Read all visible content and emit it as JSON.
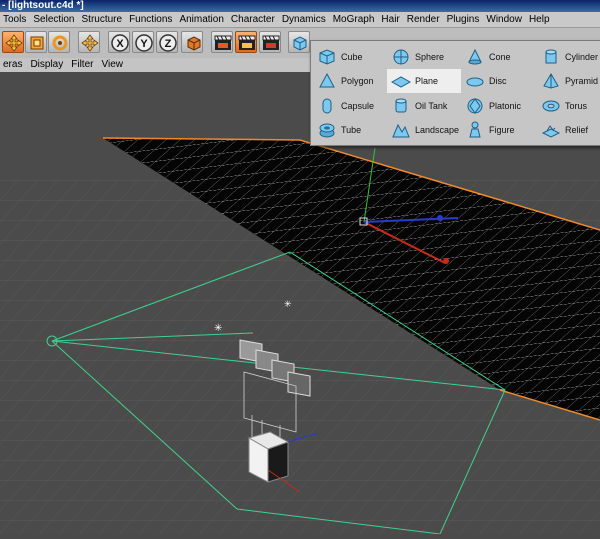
{
  "window": {
    "title": "- [lightsout.c4d *]"
  },
  "menubar": {
    "items": [
      "Tools",
      "Selection",
      "Structure",
      "Functions",
      "Animation",
      "Character",
      "Dynamics",
      "MoGraph",
      "Hair",
      "Render",
      "Plugins",
      "Window",
      "Help"
    ]
  },
  "toolbar": {
    "buttons": [
      "move-tool",
      "scale-tool",
      "rotate-tool",
      "live-selection",
      "x-axis-lock",
      "y-axis-lock",
      "z-axis-lock",
      "coordinate-system",
      "render-view",
      "render-picture-viewer",
      "edit-render-settings",
      "make-editable",
      "cube-primitive-menu"
    ]
  },
  "view_menu": {
    "items": [
      "eras",
      "Display",
      "Filter",
      "View"
    ]
  },
  "primitives_palette": {
    "items": [
      {
        "label": "Cube",
        "icon": "cube-icon"
      },
      {
        "label": "Polygon",
        "icon": "polygon-icon"
      },
      {
        "label": "Capsule",
        "icon": "capsule-icon"
      },
      {
        "label": "Tube",
        "icon": "tube-icon"
      },
      {
        "label": "Sphere",
        "icon": "sphere-icon"
      },
      {
        "label": "Plane",
        "icon": "plane-icon",
        "highlighted": true
      },
      {
        "label": "Oil Tank",
        "icon": "oil-tank-icon"
      },
      {
        "label": "Landscape",
        "icon": "landscape-icon"
      },
      {
        "label": "Cone",
        "icon": "cone-icon"
      },
      {
        "label": "Disc",
        "icon": "disc-icon"
      },
      {
        "label": "Platonic",
        "icon": "platonic-icon"
      },
      {
        "label": "Figure",
        "icon": "figure-icon"
      },
      {
        "label": "Cylinder",
        "icon": "cylinder-icon"
      },
      {
        "label": "Pyramid",
        "icon": "pyramid-icon"
      },
      {
        "label": "Torus",
        "icon": "torus-icon"
      },
      {
        "label": "Relief",
        "icon": "relief-icon"
      }
    ]
  },
  "colors": {
    "accent": "#f08a2a",
    "icon_blue": "#5cb8e6",
    "grid": "#6a6a6a",
    "light_cone": "#3fd18f"
  }
}
